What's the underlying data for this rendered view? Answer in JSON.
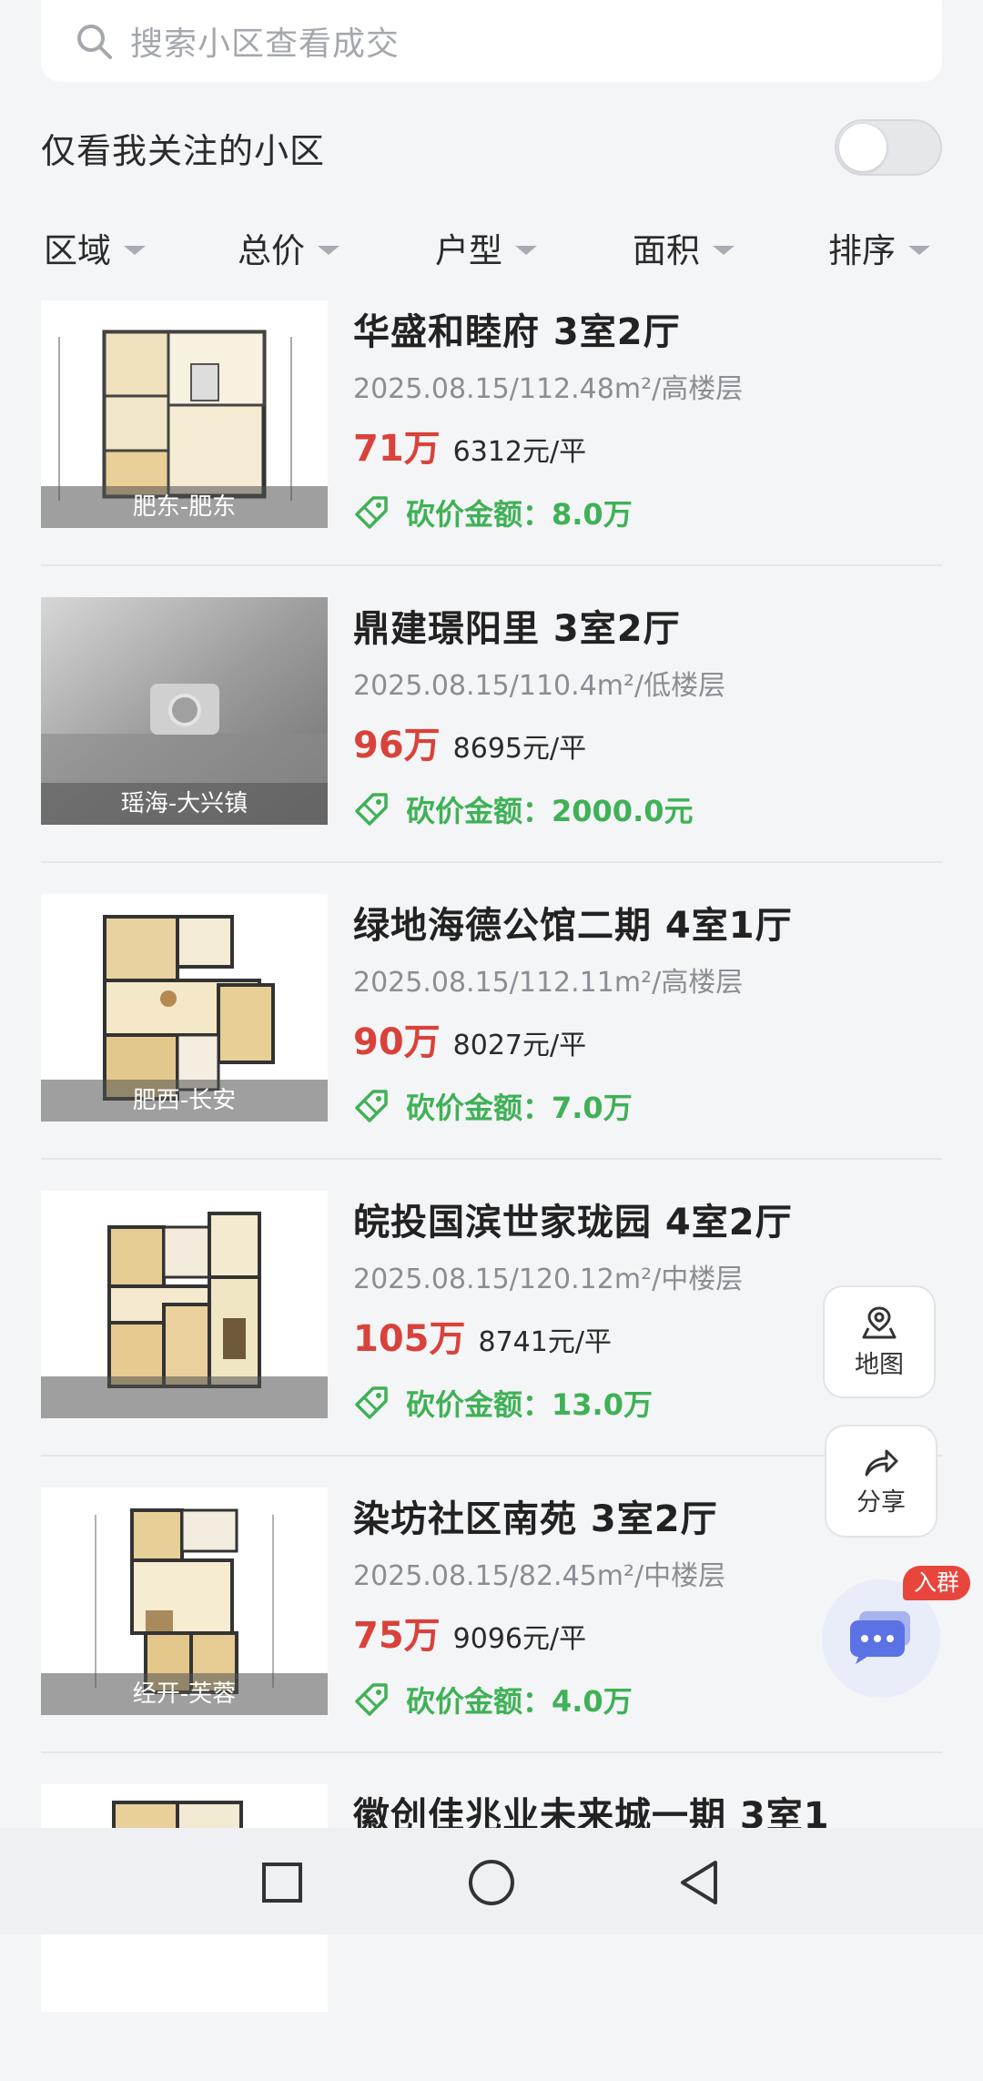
{
  "search": {
    "placeholder": "搜索小区查看成交"
  },
  "follow": {
    "label": "仅看我关注的小区",
    "enabled": false
  },
  "filters": [
    "区域",
    "总价",
    "户型",
    "面积",
    "排序"
  ],
  "listings": [
    {
      "title": "华盛和睦府 3室2厅",
      "meta": "2025.08.15/112.48m²/高楼层",
      "price": "71万",
      "unit_price": "6312元/平",
      "bargain": "砍价金额：8.0万",
      "district": "肥东-肥东",
      "image": "floorplan"
    },
    {
      "title": "鼎建璟阳里 3室2厅",
      "meta": "2025.08.15/110.4m²/低楼层",
      "price": "96万",
      "unit_price": "8695元/平",
      "bargain": "砍价金额：2000.0元",
      "district": "瑶海-大兴镇",
      "image": "placeholder-photo"
    },
    {
      "title": "绿地海德公馆二期 4室1厅",
      "meta": "2025.08.15/112.11m²/高楼层",
      "price": "90万",
      "unit_price": "8027元/平",
      "bargain": "砍价金额：7.0万",
      "district": "肥西-长安",
      "image": "floorplan"
    },
    {
      "title": "皖投国滨世家珑园 4室2厅",
      "meta": "2025.08.15/120.12m²/中楼层",
      "price": "105万",
      "unit_price": "8741元/平",
      "bargain": "砍价金额：13.0万",
      "district": "",
      "image": "floorplan"
    },
    {
      "title": "染坊社区南苑 3室2厅",
      "meta": "2025.08.15/82.45m²/中楼层",
      "price": "75万",
      "unit_price": "9096元/平",
      "bargain": "砍价金额：4.0万",
      "district": "经开-芙蓉",
      "image": "floorplan"
    },
    {
      "title": "徽创佳兆业未来城一期 3室1",
      "meta": "",
      "price": "",
      "unit_price": "",
      "bargain": "",
      "district": "",
      "image": "floorplan"
    }
  ],
  "float_buttons": {
    "map_label": "地图",
    "share_label": "分享"
  },
  "chat": {
    "badge": "入群"
  },
  "colors": {
    "price": "#d9423a",
    "bargain": "#3fb156",
    "background": "#f4f5f7"
  },
  "icons": [
    "search-icon",
    "price-tag-icon",
    "map-pin-icon",
    "share-arrow-icon",
    "chat-bubble-icon",
    "square-nav-icon",
    "circle-nav-icon",
    "back-triangle-icon"
  ]
}
